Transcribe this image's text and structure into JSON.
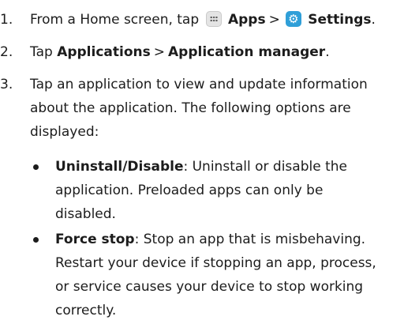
{
  "steps": [
    {
      "number": "1.",
      "prefix": "From a Home screen, tap",
      "apps_label": "Apps",
      "separator": ">",
      "settings_label": "Settings",
      "suffix": "."
    },
    {
      "number": "2.",
      "prefix": "Tap",
      "applications_label": "Applications",
      "separator": ">",
      "manager_label": "Application manager",
      "suffix": "."
    },
    {
      "number": "3.",
      "lines": [
        "Tap an application to view and update information",
        "about the application. The following options are",
        "displayed:"
      ]
    }
  ],
  "options": [
    {
      "term": "Uninstall/Disable",
      "lines": [
        ": Uninstall or disable the",
        "application. Preloaded apps can only be",
        "disabled."
      ]
    },
    {
      "term": "Force stop",
      "lines": [
        ": Stop an app that is misbehaving.",
        "Restart your device if stopping an app, process,",
        "or service causes your device to stop working",
        "correctly."
      ]
    }
  ],
  "icons": {
    "apps": "apps-grid-icon",
    "settings": "settings-gear-icon",
    "settings_color": "#2f9fd8"
  }
}
